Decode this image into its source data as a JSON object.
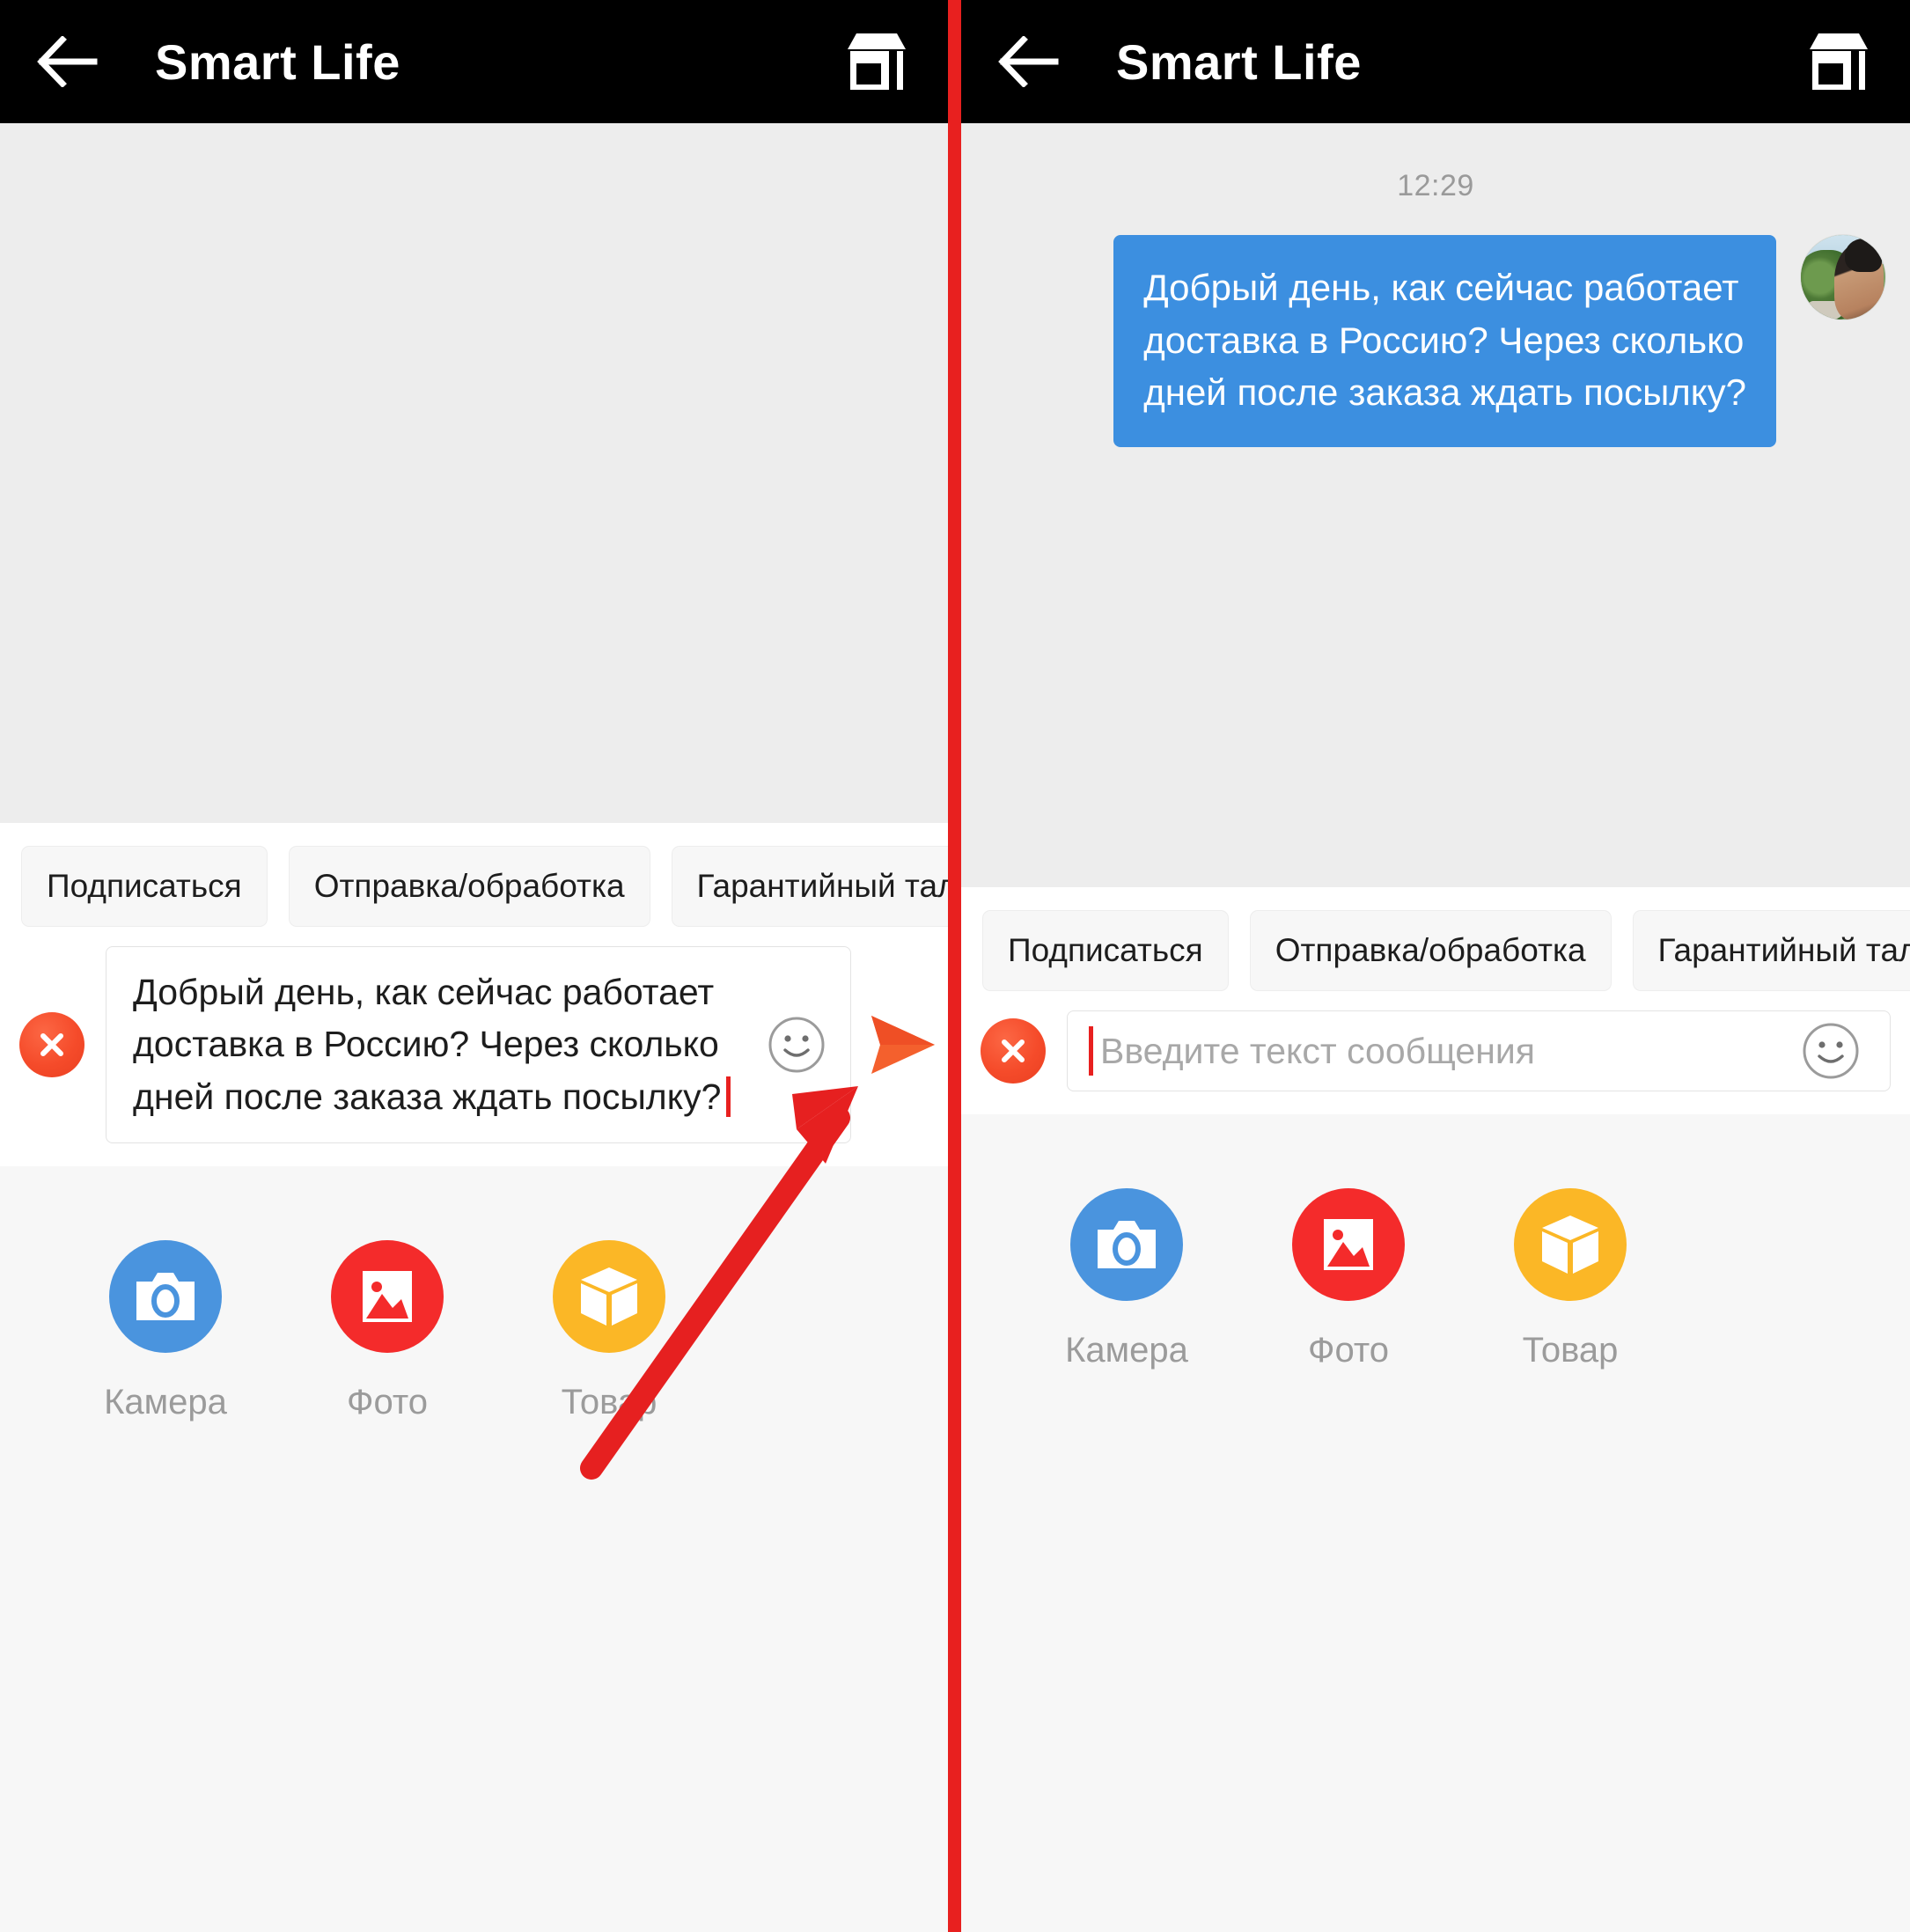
{
  "app": {
    "title": "Smart Life",
    "back_icon": "arrow-left-icon",
    "store_icon": "store-icon"
  },
  "panels": [
    {
      "id": "left",
      "state": "message-typed",
      "chat": {
        "timestamp": "",
        "messages": []
      },
      "composer": {
        "value_lines": [
          "Добрый день, как сейчас работает",
          "доставка в Россию? Через сколько",
          "дней после заказа ждать посылку?"
        ],
        "placeholder": "",
        "close_icon": "close-circle-icon",
        "emoji_icon": "smiley-icon",
        "send_icon": "send-arrow-icon"
      }
    },
    {
      "id": "right",
      "state": "message-sent",
      "chat": {
        "timestamp": "12:29",
        "messages": [
          {
            "author": "me",
            "avatar": "user-avatar",
            "lines": [
              "Добрый день, как сейчас работает",
              "доставка в Россию? Через сколько",
              "дней после заказа ждать посылку?"
            ]
          }
        ]
      },
      "composer": {
        "value_lines": [],
        "placeholder": "Введите текст сообщения",
        "close_icon": "close-circle-icon",
        "emoji_icon": "smiley-icon",
        "send_icon": ""
      }
    }
  ],
  "quick_replies": [
    "Подписаться",
    "Отправка/обработка",
    "Гарантийный талон"
  ],
  "attachments": [
    {
      "label": "Камера",
      "icon": "camera-icon",
      "color": "#4a94de"
    },
    {
      "label": "Фото",
      "icon": "photo-icon",
      "color": "#f42b2b"
    },
    {
      "label": "Товар",
      "icon": "box-icon",
      "color": "#fbb726"
    }
  ],
  "colors": {
    "appbar_bg": "#000000",
    "divider_red": "#e8201f",
    "bubble_blue": "#3c8fe0",
    "close_orange": "#f54b2a",
    "send_orange": "#f4602d",
    "chat_bg": "#ededed",
    "panel_bg": "#f7f7f7",
    "annotation_red": "#e62020"
  },
  "annotation": {
    "type": "arrow",
    "description": "red arrow pointing to send button"
  }
}
